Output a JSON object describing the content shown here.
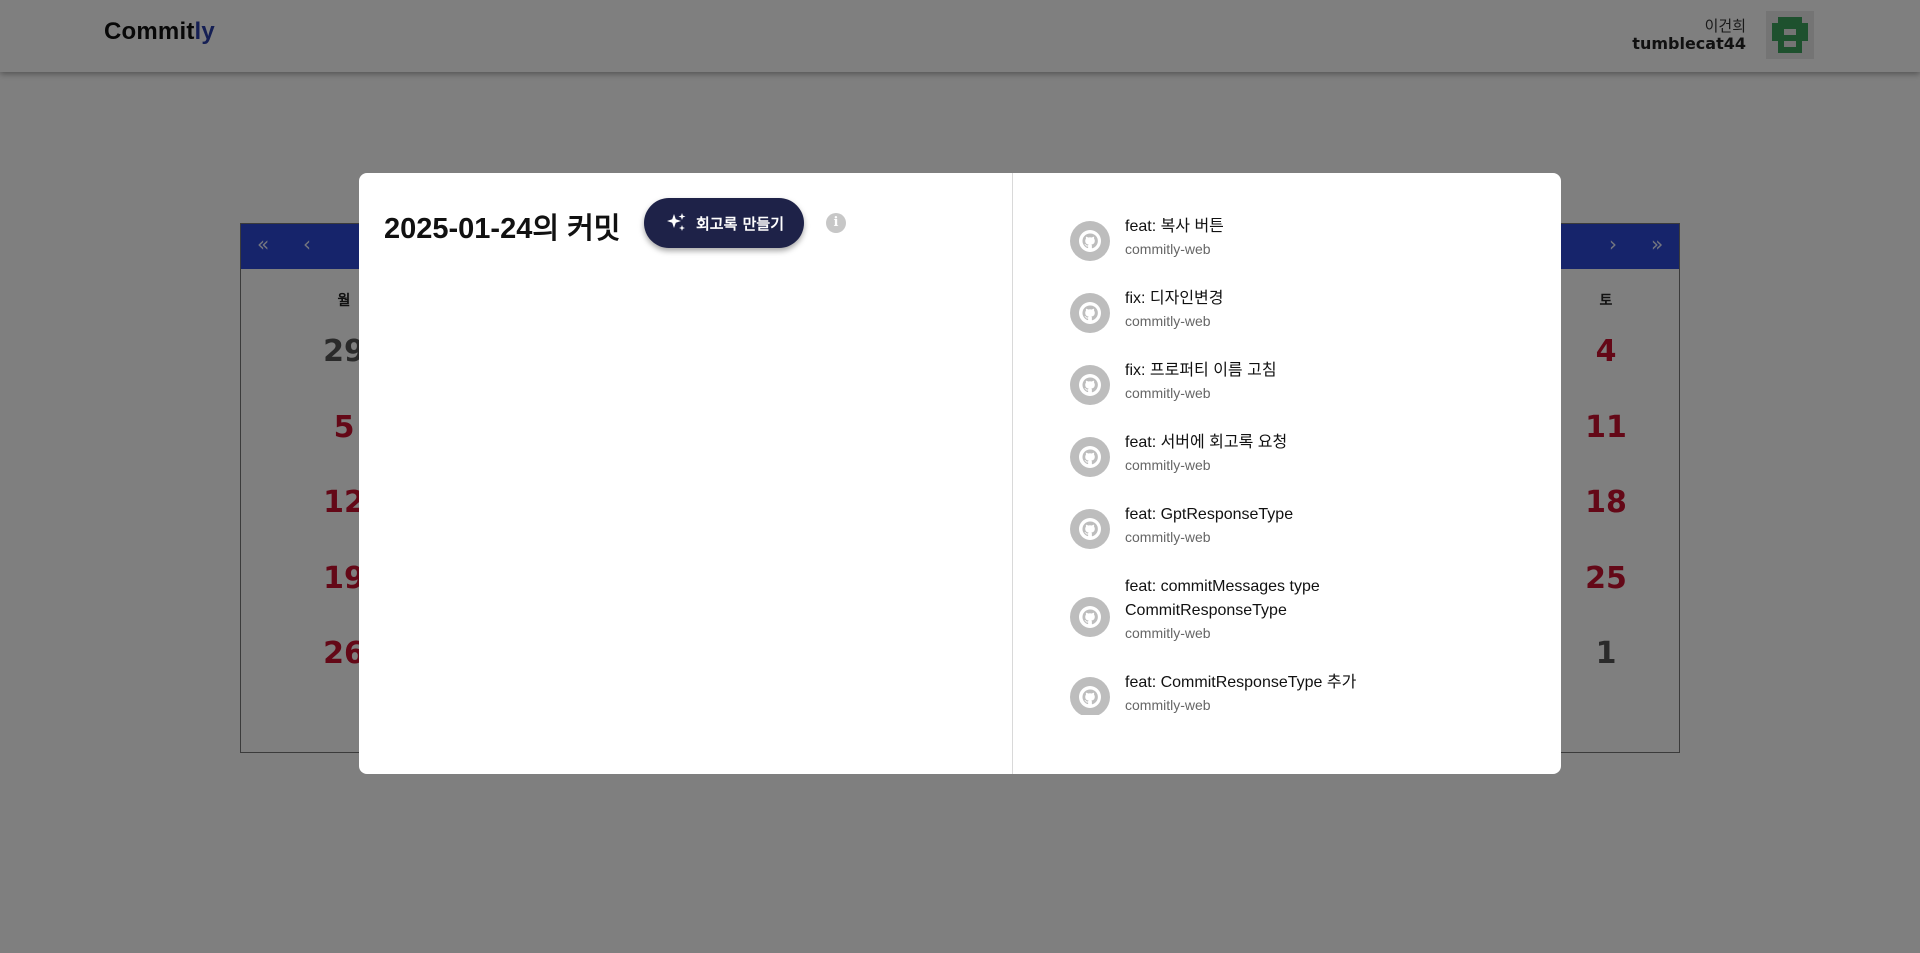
{
  "header": {
    "logo_main": "Commit",
    "logo_accent": "ly",
    "user_name": "이건희",
    "user_id": "tumblecat44",
    "accent_color": "#2b3fa8"
  },
  "calendar": {
    "nav": {
      "first": "«",
      "prev": "‹",
      "next": "›",
      "last": "»"
    },
    "weekdays": {
      "mon": "월",
      "sat": "토"
    },
    "mon_days": [
      "29",
      "5",
      "12",
      "19",
      "26"
    ],
    "sat_days": [
      "4",
      "11",
      "18",
      "25",
      "1"
    ],
    "nav_color": "#2c48d6",
    "weekend_color": "#c8102e"
  },
  "modal": {
    "title": "2025-01-24의 커밋",
    "create_button": "회고록 만들기",
    "info_icon": "i",
    "commits": [
      {
        "message": "feat: 복사 버튼",
        "repo": "commitly-web"
      },
      {
        "message": "fix: 디자인변경",
        "repo": "commitly-web"
      },
      {
        "message": "fix: 프로퍼티 이름 고침",
        "repo": "commitly-web"
      },
      {
        "message": "feat: 서버에 회고록 요청",
        "repo": "commitly-web"
      },
      {
        "message": "feat: GptResponseType",
        "repo": "commitly-web"
      },
      {
        "message": "feat: commitMessages type CommitResponseType",
        "repo": "commitly-web"
      },
      {
        "message": "feat: CommitResponseType 추가",
        "repo": "commitly-web"
      }
    ],
    "button_color": "#1e2248"
  }
}
